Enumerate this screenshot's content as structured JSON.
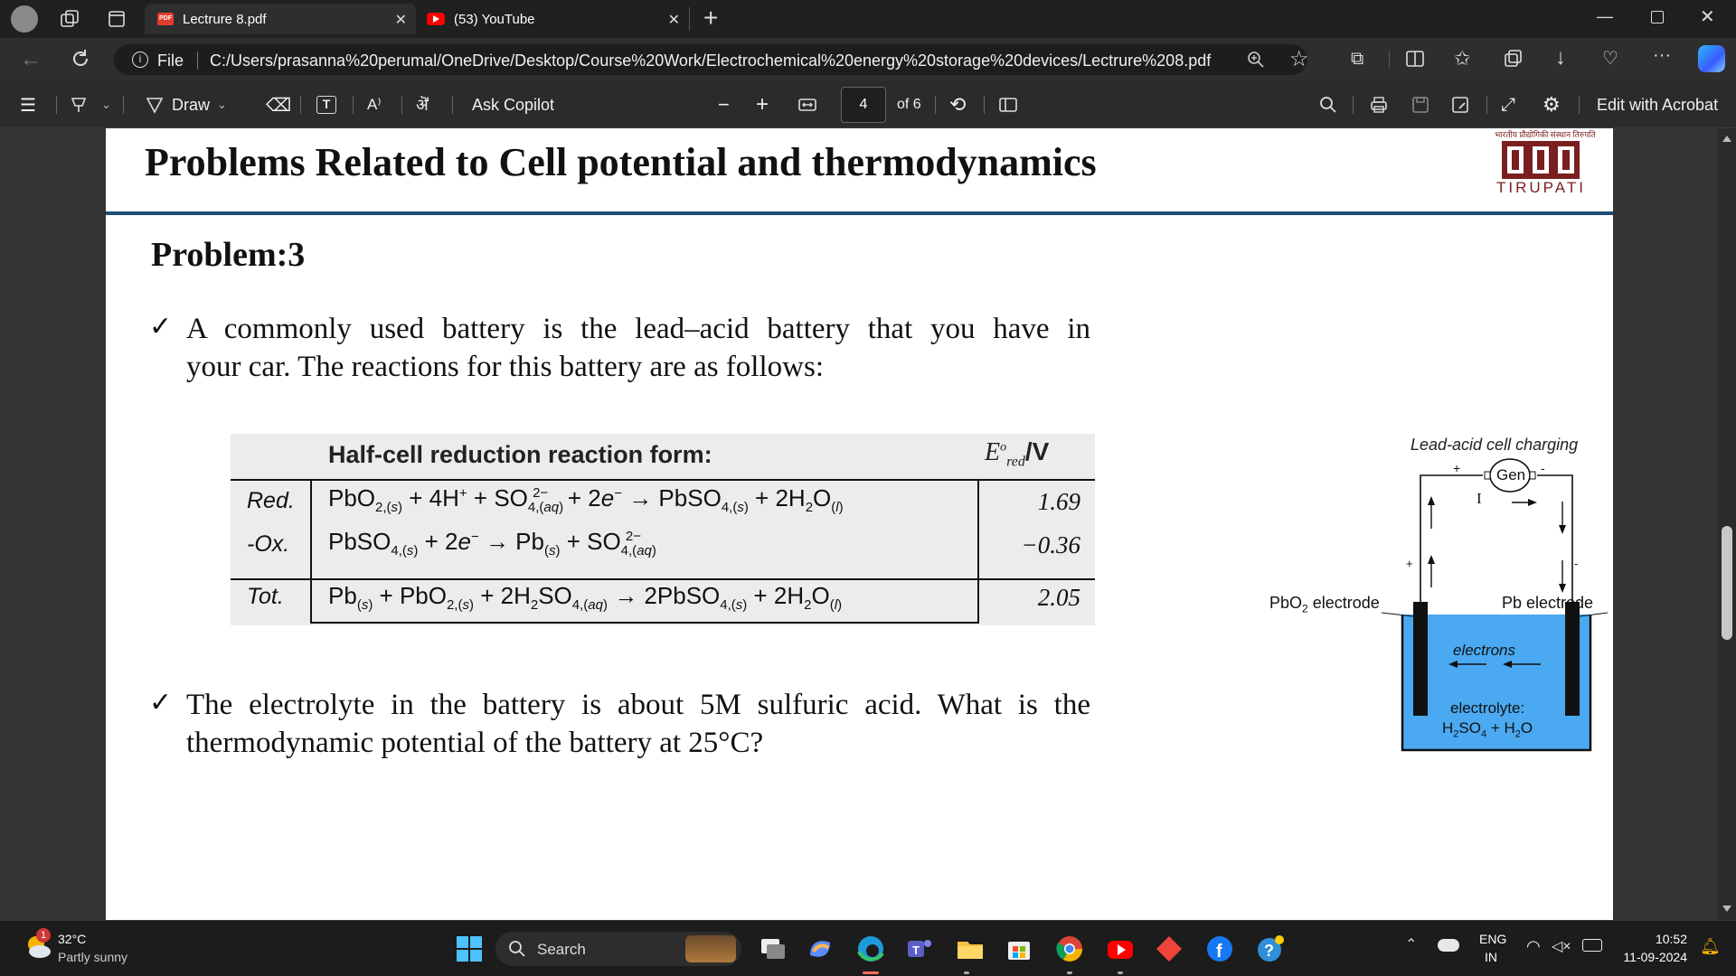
{
  "tabs": [
    {
      "title": "Lectrure 8.pdf",
      "icon": "pdf-icon"
    },
    {
      "title": "(53) YouTube",
      "icon": "youtube-icon"
    }
  ],
  "address": {
    "scheme_label": "File",
    "url": "C:/Users/prasanna%20perumal/OneDrive/Desktop/Course%20Work/Electrochemical%20energy%20storage%20devices/Lectrure%208.pdf"
  },
  "pdf_toolbar": {
    "draw_label": "Draw",
    "copilot_label": "Ask Copilot",
    "page_current": "4",
    "page_total": "of 6",
    "edit_label": "Edit with Acrobat"
  },
  "slide": {
    "title": "Problems Related to Cell potential and thermodynamics",
    "logo_top": "भारतीय प्रौद्योगिकी संस्थान तिरुपति",
    "logo_name": "TIRUPATI",
    "problem_heading": "Problem:3",
    "bullet1_line1": "A commonly used battery is the lead–acid battery that you have in",
    "bullet1_line2": "your car. The reactions for this battery are as follows:",
    "bullet2_line1": "The electrolyte in the battery is about 5M sulfuric acid. What is the",
    "bullet2_line2": "thermodynamic potential of the battery at 25°C?",
    "table": {
      "header": "Half-cell reduction reaction form:",
      "header_unit": "/V",
      "rows": [
        {
          "label": "Red.",
          "value": "1.69"
        },
        {
          "label": "-Ox.",
          "value": "−0.36"
        },
        {
          "label": "Tot.",
          "value": "2.05"
        }
      ]
    },
    "diagram": {
      "title": "Lead-acid cell charging",
      "gen": "Gen",
      "current": "I",
      "left_label": "PbO",
      "left_label_rest": " electrode",
      "right_label": "Pb electrode",
      "electrons": "electrons",
      "electrolyte": "electrolyte:",
      "plus": "+",
      "minus": "-"
    }
  },
  "taskbar": {
    "weather_temp": "32°C",
    "weather_desc": "Partly sunny",
    "weather_badge": "1",
    "search_label": "Search",
    "lang1": "ENG",
    "lang2": "IN",
    "time": "10:52",
    "date": "11-09-2024"
  },
  "colors": {
    "accent": "#0078d4",
    "slide_rule": "#1f4e79",
    "electrolyte": "#4aa9f0"
  }
}
